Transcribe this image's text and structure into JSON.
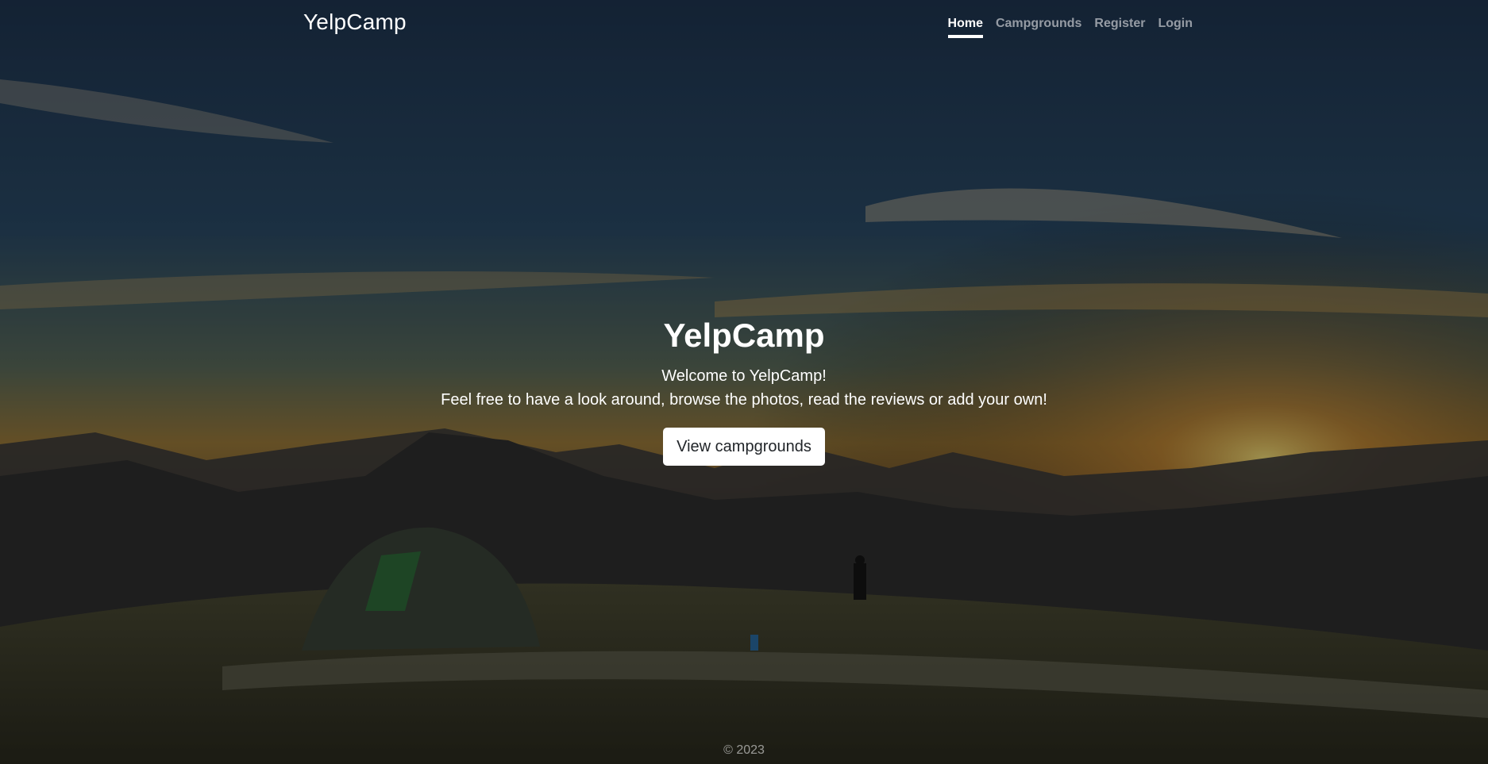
{
  "nav": {
    "brand": "YelpCamp",
    "links": [
      {
        "label": "Home",
        "active": true
      },
      {
        "label": "Campgrounds",
        "active": false
      },
      {
        "label": "Register",
        "active": false
      },
      {
        "label": "Login",
        "active": false
      }
    ]
  },
  "hero": {
    "title": "YelpCamp",
    "line1": "Welcome to YelpCamp!",
    "line2": "Feel free to have a look around, browse the photos, read the reviews or add your own!",
    "button_label": "View campgrounds"
  },
  "footer": {
    "copyright": "© 2023"
  },
  "colors": {
    "overlay": "#000000",
    "button_bg": "#ffffff",
    "button_text": "#212529",
    "nav_muted": "#8c8c8c"
  }
}
